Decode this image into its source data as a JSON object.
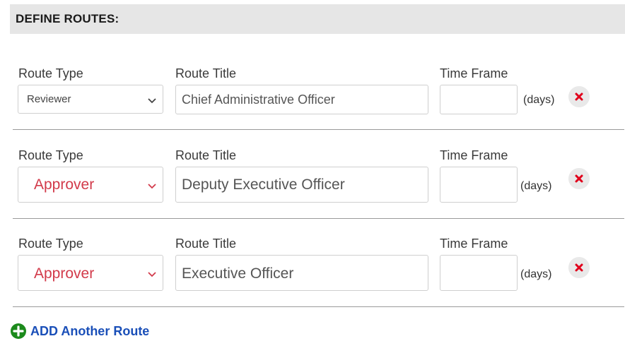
{
  "header": {
    "title": "DEFINE ROUTES:"
  },
  "routes": [
    {
      "type_label": "Route Type",
      "type_value": "Reviewer",
      "title_label": "Route Title",
      "title_value": "Chief Administrative Officer",
      "time_label": "Time Frame",
      "time_value": "",
      "days_label": "(days)"
    },
    {
      "type_label": "Route Type",
      "type_value": "Approver",
      "title_label": "Route Title",
      "title_value": "Deputy Executive Officer",
      "time_label": "Time Frame",
      "time_value": "",
      "days_label": "(days)"
    },
    {
      "type_label": "Route Type",
      "type_value": "Approver",
      "title_label": "Route Title",
      "title_value": "Executive Officer",
      "time_label": "Time Frame",
      "time_value": "",
      "days_label": "(days)"
    }
  ],
  "add_route": {
    "label": "ADD Another Route",
    "icon": "plus-circle-icon"
  },
  "icons": {
    "remove": "close-icon",
    "dropdown": "chevron-down-icon"
  },
  "colors": {
    "remove_x": "#e0001b",
    "add_icon": "#1c8a1c",
    "add_text": "#1a4fb8",
    "approver_text": "#d23a4a"
  }
}
